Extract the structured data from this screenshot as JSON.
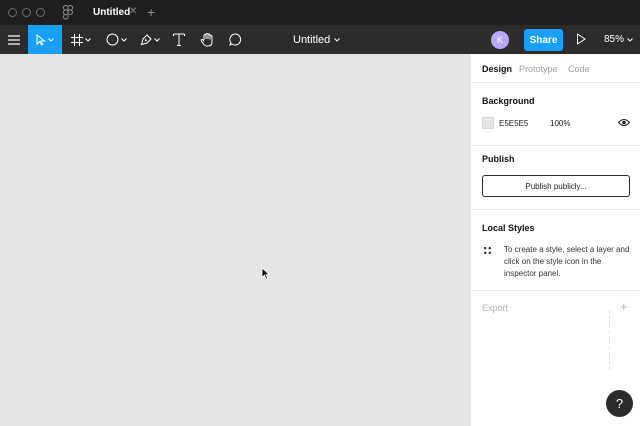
{
  "titlebar": {
    "tab": {
      "label": "Untitled",
      "close": "✕"
    },
    "add_tab": "+"
  },
  "toolbar": {
    "file_title": "Untitled",
    "avatar_initial": "K",
    "share_label": "Share",
    "zoom_label": "85%",
    "active_tool": "move-tool"
  },
  "canvas": {
    "background": "#E5E5E5"
  },
  "panel": {
    "tabs": [
      {
        "label": "Design",
        "active": true
      },
      {
        "label": "Prototype",
        "active": false
      },
      {
        "label": "Code",
        "active": false
      }
    ],
    "background": {
      "title": "Background",
      "hex": "E5E5E5",
      "opacity": "100%"
    },
    "publish": {
      "title": "Publish",
      "button_label": "Publish publicly..."
    },
    "local_styles": {
      "title": "Local Styles",
      "hint": "To create a style, select a layer and click on the style icon in the inspector panel."
    },
    "export": {
      "title": "Export",
      "add": "+"
    }
  },
  "help_label": "?",
  "colors": {
    "accent": "#18A0FB",
    "toolbar": "#2C2C2C",
    "titlebar": "#1E1E1E",
    "avatar": "#B9A6F7"
  }
}
